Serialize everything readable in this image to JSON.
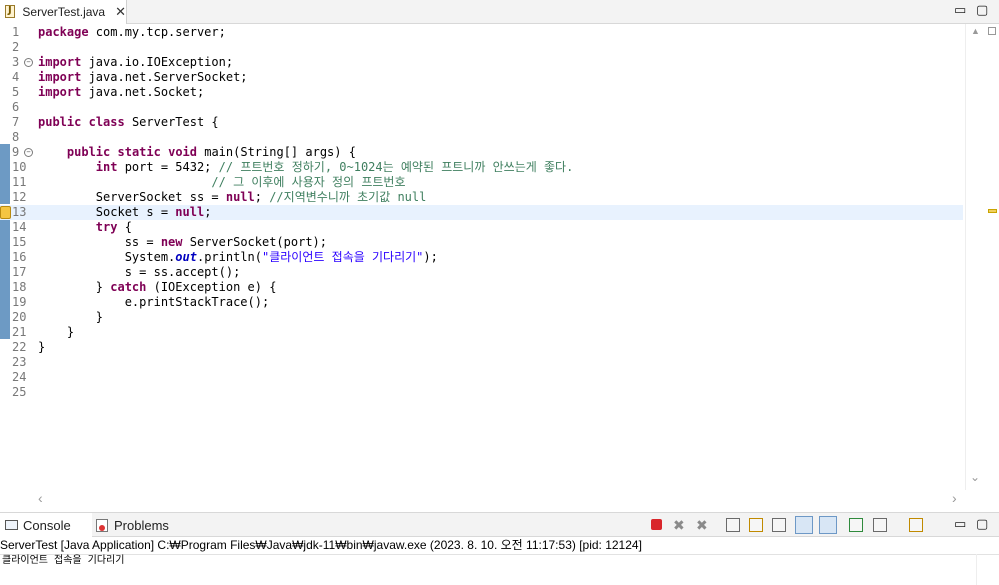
{
  "editor_tab": {
    "title": "ServerTest.java",
    "close_glyph": "✕",
    "icon": "java-file-icon"
  },
  "window_controls": {
    "minimize": "▭",
    "maximize": "▢",
    "console_minimize": "▭",
    "console_maximize": "▢"
  },
  "code_lines": [
    {
      "n": "1",
      "code": "package com.my.tcp.server;"
    },
    {
      "n": "2",
      "code": ""
    },
    {
      "n": "3",
      "code": "import java.io.IOException;",
      "fold": true
    },
    {
      "n": "4",
      "code": "import java.net.ServerSocket;"
    },
    {
      "n": "5",
      "code": "import java.net.Socket;"
    },
    {
      "n": "6",
      "code": ""
    },
    {
      "n": "7",
      "code": "public class ServerTest {"
    },
    {
      "n": "8",
      "code": ""
    },
    {
      "n": "9",
      "code": "    public static void main(String[] args) {",
      "fold": true
    },
    {
      "n": "10",
      "code": "        int port = 5432; // 프트번호 정하기, 0~1024는 예약된 프트니까 안쓰는게 좋다."
    },
    {
      "n": "11",
      "code": "                        // 그 이후에 사용자 정의 프트번호"
    },
    {
      "n": "12",
      "code": "        ServerSocket ss = null; //지역변수니까 초기값 null"
    },
    {
      "n": "13",
      "code": "        Socket s = null;",
      "current": true,
      "warning": true
    },
    {
      "n": "14",
      "code": "        try {"
    },
    {
      "n": "15",
      "code": "            ss = new ServerSocket(port);"
    },
    {
      "n": "16",
      "code": "            System.out.println(\"클라이언트 접속을 기다리기\");"
    },
    {
      "n": "17",
      "code": "            s = ss.accept();"
    },
    {
      "n": "18",
      "code": "        } catch (IOException e) {"
    },
    {
      "n": "19",
      "code": "            e.printStackTrace();"
    },
    {
      "n": "20",
      "code": "        }"
    },
    {
      "n": "21",
      "code": "    }"
    },
    {
      "n": "22",
      "code": "}"
    },
    {
      "n": "23",
      "code": ""
    },
    {
      "n": "24",
      "code": ""
    },
    {
      "n": "25",
      "code": ""
    }
  ],
  "scroll_glyphs": {
    "up": "▲",
    "down": "⌄",
    "left": "‹",
    "right": "›"
  },
  "console_tabs": [
    {
      "label": "Console",
      "icon": "console-icon",
      "active": true
    },
    {
      "label": "Problems",
      "icon": "problems-icon",
      "active": false
    }
  ],
  "console": {
    "header": "ServerTest [Java Application] C:₩Program Files₩Java₩jdk-11₩bin₩javaw.exe  (2023. 8. 10. 오전 11:17:53) [pid: 12124]",
    "output": "클라이언트 접속을 기다리기"
  },
  "console_toolbar": [
    {
      "name": "terminate-icon",
      "color": "#d9262b"
    },
    {
      "name": "remove-launch-icon",
      "color": "#8a8a8a"
    },
    {
      "name": "remove-all-terminated-icon",
      "color": "#8a8a8a"
    },
    {
      "name": "clear-console-icon",
      "color": "#6a6a6a"
    },
    {
      "name": "scroll-lock-icon",
      "color": "#c08a00"
    },
    {
      "name": "word-wrap-icon",
      "color": "#6a6a6a"
    },
    {
      "name": "show-on-stdout-icon",
      "color": "#3d7ab8"
    },
    {
      "name": "show-on-stderr-icon",
      "color": "#c03030"
    },
    {
      "name": "pin-console-icon",
      "color": "#2f8a3c"
    },
    {
      "name": "display-console-icon",
      "color": "#6a6a6a"
    },
    {
      "name": "open-console-icon",
      "color": "#c08a00"
    }
  ],
  "colors": {
    "keyword": "#7f0055",
    "comment": "#3f7f5f",
    "string": "#2a00ff",
    "static_field": "#0000c0",
    "current_line": "#e8f2fe",
    "quick_diff": "#3c78b0"
  }
}
